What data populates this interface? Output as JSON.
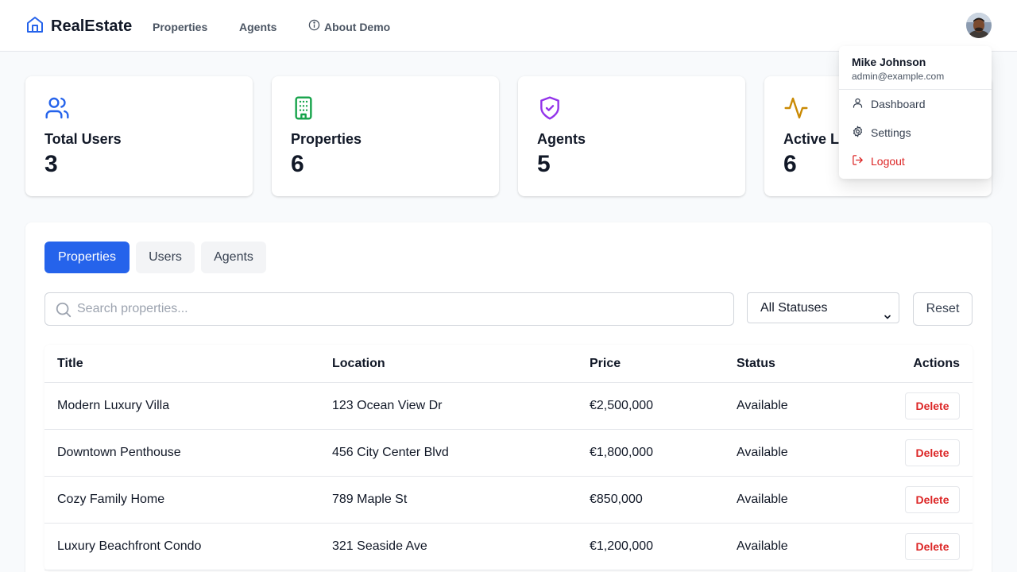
{
  "brand": {
    "name": "RealEstate"
  },
  "nav": {
    "properties": "Properties",
    "agents": "Agents",
    "about": "About Demo"
  },
  "user_menu": {
    "name": "Mike Johnson",
    "email": "admin@example.com",
    "items": [
      {
        "label": "Dashboard",
        "icon": "user-icon"
      },
      {
        "label": "Settings",
        "icon": "gear-icon"
      },
      {
        "label": "Logout",
        "icon": "logout-icon"
      }
    ]
  },
  "stats": [
    {
      "title": "Total Users",
      "value": "3",
      "icon": "users-icon",
      "color": "#2563eb"
    },
    {
      "title": "Properties",
      "value": "6",
      "icon": "building-icon",
      "color": "#16a34a"
    },
    {
      "title": "Agents",
      "value": "5",
      "icon": "shield-check-icon",
      "color": "#9333ea"
    },
    {
      "title": "Active Listings",
      "value": "6",
      "icon": "activity-icon",
      "color": "#ca8a04"
    }
  ],
  "tabs": [
    {
      "label": "Properties",
      "active": true
    },
    {
      "label": "Users",
      "active": false
    },
    {
      "label": "Agents",
      "active": false
    }
  ],
  "filters": {
    "search_placeholder": "Search properties...",
    "status_selected": "All Statuses",
    "reset_label": "Reset"
  },
  "table": {
    "columns": [
      "Title",
      "Location",
      "Price",
      "Status",
      "Actions"
    ],
    "rows": [
      {
        "title": "Modern Luxury Villa",
        "location": "123 Ocean View Dr",
        "price": "€2,500,000",
        "status": "Available",
        "action": "Delete"
      },
      {
        "title": "Downtown Penthouse",
        "location": "456 City Center Blvd",
        "price": "€1,800,000",
        "status": "Available",
        "action": "Delete"
      },
      {
        "title": "Cozy Family Home",
        "location": "789 Maple St",
        "price": "€850,000",
        "status": "Available",
        "action": "Delete"
      },
      {
        "title": "Luxury Beachfront Condo",
        "location": "321 Seaside Ave",
        "price": "€1,200,000",
        "status": "Available",
        "action": "Delete"
      }
    ]
  },
  "colors": {
    "accent": "#2563eb",
    "danger": "#dc2626"
  }
}
